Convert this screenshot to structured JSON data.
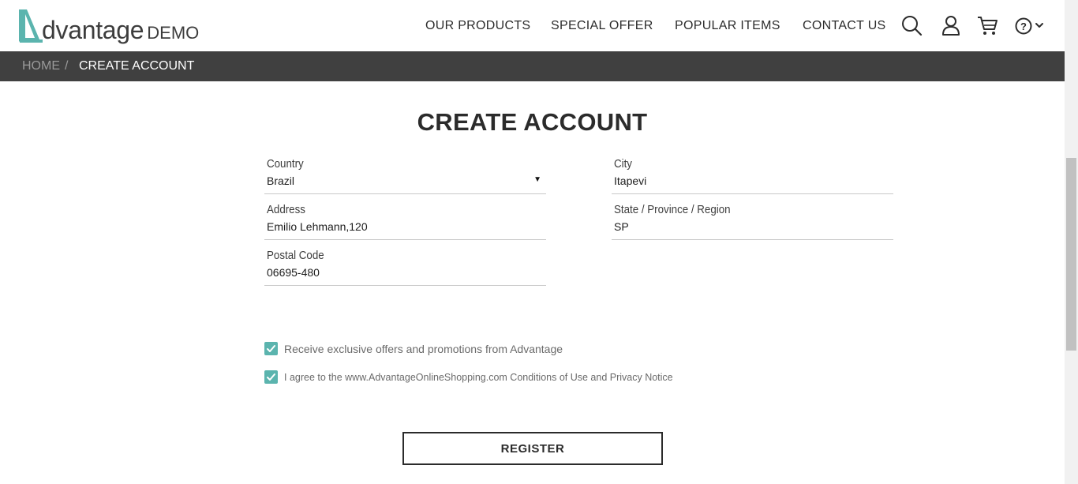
{
  "brand": {
    "logo_letter": "A",
    "word": "dvantage",
    "demo": "DEMO",
    "accent_color": "#5bb4ae"
  },
  "nav": {
    "items": [
      {
        "label": "OUR PRODUCTS"
      },
      {
        "label": "SPECIAL OFFER"
      },
      {
        "label": "POPULAR ITEMS"
      },
      {
        "label": "CONTACT US"
      }
    ],
    "icons": [
      "search-icon",
      "user-icon",
      "cart-icon",
      "help-icon",
      "chevron-down-icon"
    ]
  },
  "breadcrumb": {
    "home": "HOME",
    "separator": "/",
    "current": "CREATE ACCOUNT"
  },
  "page": {
    "title": "CREATE ACCOUNT"
  },
  "form": {
    "country": {
      "label": "Country",
      "value": "Brazil"
    },
    "city": {
      "label": "City",
      "value": "Itapevi"
    },
    "address": {
      "label": "Address",
      "value": "Emilio Lehmann,120"
    },
    "state": {
      "label": "State / Province / Region",
      "value": "SP"
    },
    "postal": {
      "label": "Postal Code",
      "value": "06695-480"
    }
  },
  "options": {
    "offers": {
      "label": "Receive exclusive offers and promotions from Advantage",
      "checked": true
    },
    "terms": {
      "label": "I agree to the www.AdvantageOnlineShopping.com Conditions of Use and Privacy Notice",
      "checked": true
    }
  },
  "actions": {
    "register": "REGISTER"
  },
  "colors": {
    "breadcrumb_bg": "#404040",
    "checkbox": "#5bb4ae"
  }
}
